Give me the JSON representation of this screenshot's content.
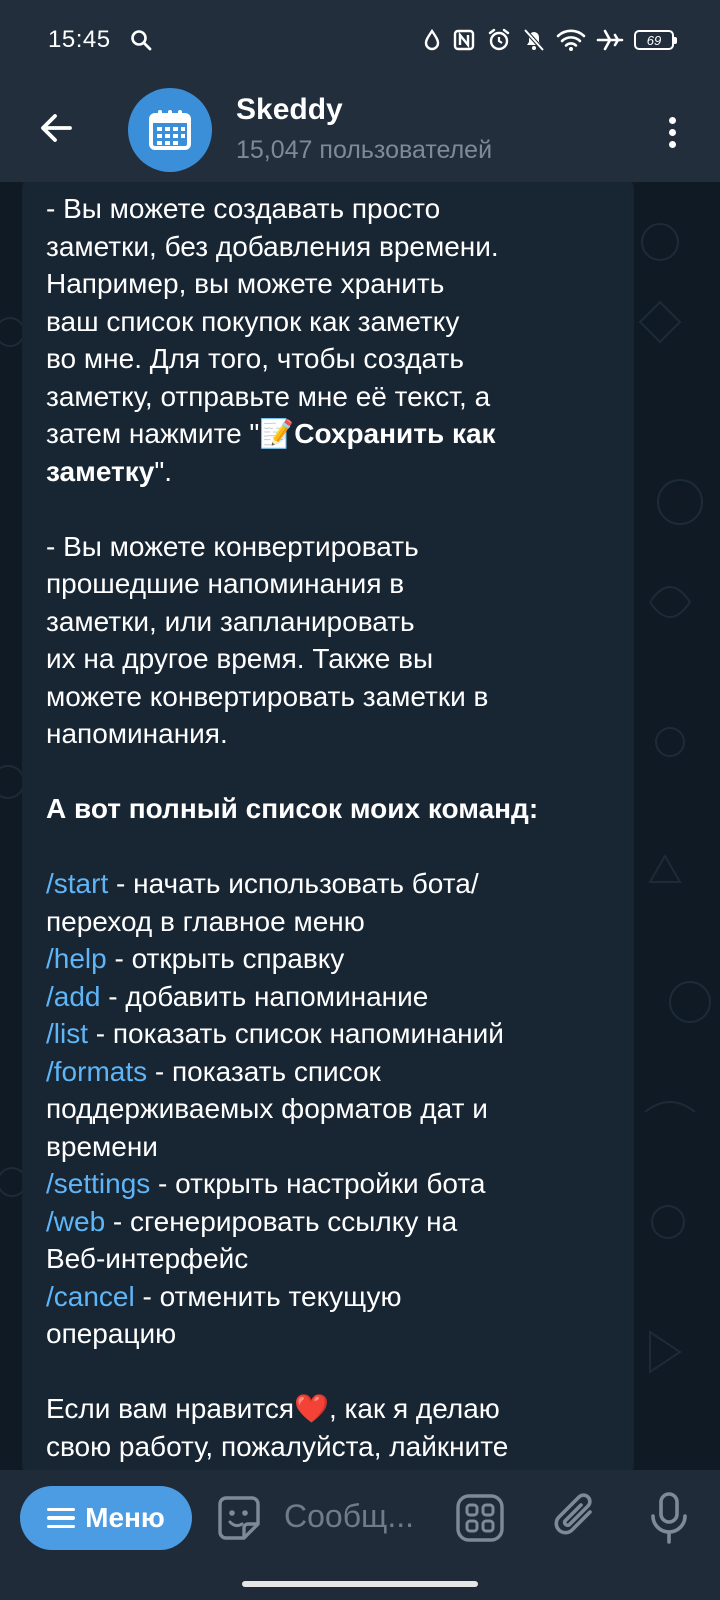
{
  "status": {
    "time": "15:45",
    "battery": "69"
  },
  "header": {
    "title": "Skeddy",
    "subtitle": "15,047 пользователей"
  },
  "message": {
    "p1": {
      "line1": "- Вы можете создавать просто",
      "line2": "заметки, без добавления времени.",
      "line3": "Например, вы можете хранить",
      "line4": "ваш список покупок как заметку",
      "line5": "во мне. Для того, чтобы создать",
      "line6": "заметку, отправьте мне её текст, а",
      "line7_pre": "затем нажмите \"",
      "line7_emoji": "📝",
      "line7_bold": "Сохранить как",
      "line8_bold": "заметку",
      "line8_post": "\"."
    },
    "p2": {
      "line1": "- Вы можете конвертировать",
      "line2": "прошедшие напоминания в",
      "line3": "заметки, или запланировать",
      "line4": "их на другое время. Также вы",
      "line5": "можете конвертировать заметки в",
      "line6": "напоминания."
    },
    "commands_heading": "А вот полный список моих команд:",
    "commands": [
      {
        "cmd": "/start",
        "desc": " - начать использовать бота/",
        "desc2": "переход в главное меню"
      },
      {
        "cmd": "/help",
        "desc": " - открыть справку"
      },
      {
        "cmd": "/add",
        "desc": " - добавить напоминание"
      },
      {
        "cmd": "/list",
        "desc": " - показать список напоминаний"
      },
      {
        "cmd": "/formats",
        "desc": " - показать список",
        "desc2": "поддерживаемых форматов дат и",
        "desc3": "времени"
      },
      {
        "cmd": "/settings",
        "desc": " - открыть настройки бота"
      },
      {
        "cmd": "/web",
        "desc": " - сгенерировать ссылку на",
        "desc2": "Веб-интерфейс"
      },
      {
        "cmd": "/cancel",
        "desc": " - отменить текущую",
        "desc2": "операцию"
      }
    ],
    "closing": {
      "line1_pre": "Если вам нравится",
      "line1_emoji": "❤️",
      "line1_post": ", как я делаю",
      "line2": "свою работу, пожалуйста, лайкните"
    }
  },
  "input": {
    "menu_label": "Меню",
    "placeholder": "Сообщ..."
  },
  "colors": {
    "link": "#5eb5f7",
    "accent": "#4c9ce3",
    "bubble": "#182533",
    "header": "#222e3b"
  },
  "icons": {
    "back": "arrow-left-icon",
    "avatar": "calendar-icon",
    "more": "more-vertical-icon",
    "menu": "hamburger-icon",
    "sticker": "sticker-icon",
    "commands": "bot-commands-icon",
    "attach": "paperclip-icon",
    "mic": "microphone-icon"
  }
}
